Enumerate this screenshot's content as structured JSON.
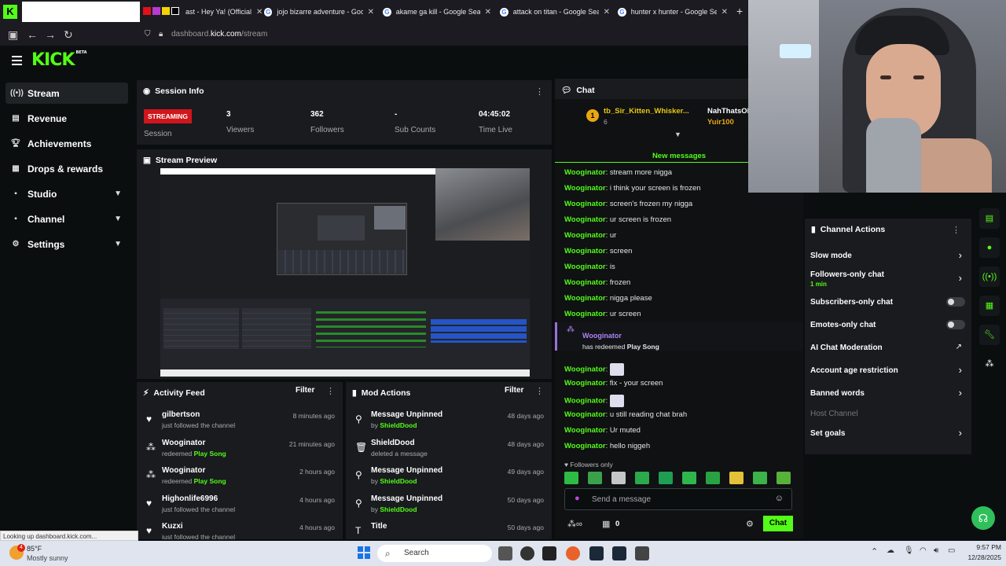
{
  "browser": {
    "tabs": [
      {
        "title": "ast - Hey Ya! (Official",
        "icon": "youtube-icon"
      },
      {
        "title": "jojo bizarre adventure - Google",
        "icon": "google-icon"
      },
      {
        "title": "akame ga kill - Google Search",
        "icon": "google-icon"
      },
      {
        "title": "attack on titan - Google Search",
        "icon": "google-icon"
      },
      {
        "title": "hunter x hunter - Google Searc",
        "icon": "google-icon"
      }
    ],
    "url_prefix": "dashboard.",
    "url_domain": "kick.com",
    "url_path": "/stream",
    "status_link": "Looking up dashboard.kick.com..."
  },
  "brand": {
    "logo": "KICK",
    "logo_tag": "BETA",
    "accent": "#53fc18"
  },
  "sidebar": {
    "items": [
      {
        "label": "Stream",
        "icon": "stream-icon",
        "active": true
      },
      {
        "label": "Revenue",
        "icon": "revenue-icon"
      },
      {
        "label": "Achievements",
        "icon": "trophy-icon"
      },
      {
        "label": "Drops & rewards",
        "icon": "gift-icon"
      },
      {
        "label": "Studio",
        "icon": "studio-icon",
        "expandable": true
      },
      {
        "label": "Channel",
        "icon": "channel-icon",
        "expandable": true
      },
      {
        "label": "Settings",
        "icon": "gear-icon",
        "expandable": true
      }
    ]
  },
  "session": {
    "title": "Session Info",
    "badge": "STREAMING",
    "badge_label": "Session",
    "stats": [
      {
        "value": "3",
        "label": "Viewers"
      },
      {
        "value": "362",
        "label": "Followers"
      },
      {
        "value": "-",
        "label": "Sub Counts"
      },
      {
        "value": "04:45:02",
        "label": "Time Live"
      }
    ]
  },
  "preview": {
    "title": "Stream Preview"
  },
  "activity": {
    "title": "Activity Feed",
    "filter": "Filter",
    "rows": [
      {
        "name": "gilbertson",
        "sub": "just followed the channel",
        "highlight": "",
        "time": "8 minutes ago",
        "icon": "heart-icon"
      },
      {
        "name": "Wooginator",
        "sub": "redeemed ",
        "highlight": "Play Song",
        "time": "21 minutes ago",
        "icon": "points-icon"
      },
      {
        "name": "Wooginator",
        "sub": "redeemed ",
        "highlight": "Play Song",
        "time": "2 hours ago",
        "icon": "points-icon"
      },
      {
        "name": "Highonlife6996",
        "sub": "just followed the channel",
        "highlight": "",
        "time": "4 hours ago",
        "icon": "heart-icon"
      },
      {
        "name": "Kuzxi",
        "sub": "just followed the channel",
        "highlight": "",
        "time": "4 hours ago",
        "icon": "heart-icon"
      }
    ]
  },
  "mod": {
    "title": "Mod Actions",
    "filter": "Filter",
    "rows": [
      {
        "name": "Message Unpinned",
        "sub": "by ",
        "highlight": "ShieldDood",
        "time": "48 days ago",
        "icon": "unpin-icon"
      },
      {
        "name": "ShieldDood",
        "sub": "deleted a message",
        "highlight": "",
        "time": "48 days ago",
        "icon": "trash-icon"
      },
      {
        "name": "Message Unpinned",
        "sub": "by ",
        "highlight": "ShieldDood",
        "time": "49 days ago",
        "icon": "unpin-icon"
      },
      {
        "name": "Message Unpinned",
        "sub": "by ",
        "highlight": "ShieldDood",
        "time": "50 days ago",
        "icon": "unpin-icon"
      },
      {
        "name": "Title",
        "sub": "",
        "highlight": "",
        "time": "50 days ago",
        "icon": "title-icon"
      }
    ]
  },
  "chat": {
    "title": "Chat",
    "pinned_user1": "tb_Sir_Kitten_Whisker...",
    "pinned_badge": "1",
    "pinned_count": "6",
    "pinned_user2": "NahThatsOl",
    "pinned_user3": "Yuir100",
    "new_messages": "New messages",
    "messages": [
      {
        "user": "Wooginator",
        "text": "stream more nigga"
      },
      {
        "user": "Wooginator",
        "text": "i think your screen is frozen"
      },
      {
        "user": "Wooginator",
        "text": "screen's frozen my nigga"
      },
      {
        "user": "Wooginator",
        "text": "ur screen is frozen"
      },
      {
        "user": "Wooginator",
        "text": "ur"
      },
      {
        "user": "Wooginator",
        "text": "screen"
      },
      {
        "user": "Wooginator",
        "text": "is"
      },
      {
        "user": "Wooginator",
        "text": "frozen"
      },
      {
        "user": "Wooginator",
        "text": "nigga please"
      },
      {
        "user": "Wooginator",
        "text": "ur screen"
      }
    ],
    "redeem_user": "Wooginator",
    "redeem_text": "has redeemed ",
    "redeem_item": "Play Song",
    "messages2": [
      {
        "user": "Wooginator",
        "text": "",
        "emote": true
      },
      {
        "user": "Wooginator",
        "text": "fix - your screen"
      },
      {
        "user": "Wooginator",
        "text": "",
        "emote": true
      },
      {
        "user": "Wooginator",
        "text": "u still reading chat brah"
      },
      {
        "user": "Wooginator",
        "text": "Ur muted"
      },
      {
        "user": "Wooginator",
        "text": "hello niggeh"
      }
    ],
    "followers_only": "Followers only",
    "input_placeholder": "Send a message",
    "points": "0",
    "send": "Chat"
  },
  "actions": {
    "title": "Channel Actions",
    "items": [
      {
        "label": "Slow mode",
        "sub": "",
        "control": "chevron"
      },
      {
        "label": "Followers-only chat",
        "sub": "1 min",
        "control": "chevron"
      },
      {
        "label": "Subscribers-only chat",
        "sub": "",
        "control": "toggle"
      },
      {
        "label": "Emotes-only chat",
        "sub": "",
        "control": "toggle"
      },
      {
        "label": "AI Chat Moderation",
        "sub": "",
        "control": "external"
      },
      {
        "label": "Account age restriction",
        "sub": "",
        "control": "chevron"
      },
      {
        "label": "Banned words",
        "sub": "",
        "control": "chevron"
      },
      {
        "label": "Host Channel",
        "sub": "",
        "control": "none",
        "disabled": true
      },
      {
        "label": "Set goals",
        "sub": "",
        "control": "chevron"
      }
    ]
  },
  "taskbar": {
    "temp": "85°F",
    "weather": "Mostly sunny",
    "search": "Search",
    "time": "9:57 PM",
    "date": "12/28/2025",
    "weather_badge": "4"
  }
}
